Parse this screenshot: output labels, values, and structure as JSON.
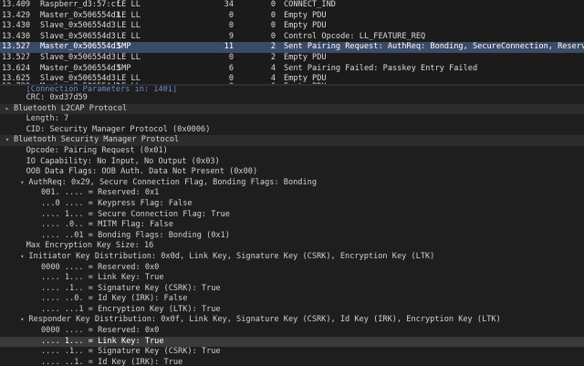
{
  "packet_list": [
    {
      "time": "13.409",
      "source": "Raspberr_d3:57:cf",
      "protocol": "LE LL",
      "length": "34",
      "num": "0",
      "info": "CONNECT_IND"
    },
    {
      "time": "13.429",
      "source": "Master_0x506554d3",
      "protocol": "LE LL",
      "length": "0",
      "num": "0",
      "info": "Empty PDU"
    },
    {
      "time": "13.430",
      "source": "Slave_0x506554d3",
      "protocol": "LE LL",
      "length": "0",
      "num": "0",
      "info": "Empty PDU"
    },
    {
      "time": "13.430",
      "source": "Slave_0x506554d3",
      "protocol": "LE LL",
      "length": "9",
      "num": "0",
      "info": "Control Opcode: LL_FEATURE_REQ"
    },
    {
      "time": "13.527",
      "source": "Master_0x506554d3",
      "protocol": "SMP",
      "length": "11",
      "num": "2",
      "info": "Sent Pairing Request: AuthReq: Bonding, SecureConnection, Reserved | I"
    },
    {
      "time": "13.527",
      "source": "Slave_0x506554d3",
      "protocol": "LE LL",
      "length": "0",
      "num": "2",
      "info": "Empty PDU"
    },
    {
      "time": "13.624",
      "source": "Master_0x506554d3",
      "protocol": "SMP",
      "length": "6",
      "num": "4",
      "info": "Sent Pairing Failed: Passkey Entry Failed"
    },
    {
      "time": "13.625",
      "source": "Slave_0x506554d3",
      "protocol": "LE LL",
      "length": "0",
      "num": "4",
      "info": "Empty PDU"
    },
    {
      "time": "13.722",
      "source": "Master_0x506554d3",
      "protocol": "LE LL",
      "length": "0",
      "num": "6",
      "info": "Empty PDU"
    }
  ],
  "detail_tree": [
    {
      "indent": 3,
      "arrow": "",
      "text": "[Connection Parameters in: 1401]",
      "partial": true
    },
    {
      "indent": 3,
      "arrow": "",
      "text": "CRC: 0xd37d59"
    },
    {
      "indent": 0,
      "arrow": "▸",
      "text": "Bluetooth L2CAP Protocol",
      "hdr": true
    },
    {
      "indent": 3,
      "arrow": "",
      "text": "Length: 7"
    },
    {
      "indent": 3,
      "arrow": "",
      "text": "CID: Security Manager Protocol (0x0006)"
    },
    {
      "indent": 0,
      "arrow": "▾",
      "text": "Bluetooth Security Manager Protocol",
      "hdr": true
    },
    {
      "indent": 3,
      "arrow": "",
      "text": "Opcode: Pairing Request (0x01)"
    },
    {
      "indent": 3,
      "arrow": "",
      "text": "IO Capability: No Input, No Output (0x03)"
    },
    {
      "indent": 3,
      "arrow": "",
      "text": "OOB Data Flags: OOB Auth. Data Not Present (0x00)"
    },
    {
      "indent": 2,
      "arrow": "▾",
      "text": "AuthReq: 0x29, Secure Connection Flag, Bonding Flags: Bonding"
    },
    {
      "indent": 5,
      "arrow": "",
      "text": "001. .... = Reserved: 0x1"
    },
    {
      "indent": 5,
      "arrow": "",
      "text": "...0 .... = Keypress Flag: False"
    },
    {
      "indent": 5,
      "arrow": "",
      "text": ".... 1... = Secure Connection Flag: True"
    },
    {
      "indent": 5,
      "arrow": "",
      "text": ".... .0.. = MITM Flag: False"
    },
    {
      "indent": 5,
      "arrow": "",
      "text": ".... ..01 = Bonding Flags: Bonding (0x1)"
    },
    {
      "indent": 3,
      "arrow": "",
      "text": "Max Encryption Key Size: 16"
    },
    {
      "indent": 2,
      "arrow": "▾",
      "text": "Initiator Key Distribution: 0x0d, Link Key, Signature Key (CSRK), Encryption Key (LTK)"
    },
    {
      "indent": 5,
      "arrow": "",
      "text": "0000 .... = Reserved: 0x0"
    },
    {
      "indent": 5,
      "arrow": "",
      "text": ".... 1... = Link Key: True"
    },
    {
      "indent": 5,
      "arrow": "",
      "text": ".... .1.. = Signature Key (CSRK): True"
    },
    {
      "indent": 5,
      "arrow": "",
      "text": ".... ..0. = Id Key (IRK): False"
    },
    {
      "indent": 5,
      "arrow": "",
      "text": ".... ...1 = Encryption Key (LTK): True"
    },
    {
      "indent": 2,
      "arrow": "▾",
      "text": "Responder Key Distribution: 0x0f, Link Key, Signature Key (CSRK), Id Key (IRK), Encryption Key (LTK)"
    },
    {
      "indent": 5,
      "arrow": "",
      "text": "0000 .... = Reserved: 0x0"
    },
    {
      "indent": 5,
      "arrow": "",
      "text": ".... 1... = Link Key: True",
      "sel": true
    },
    {
      "indent": 5,
      "arrow": "",
      "text": ".... .1.. = Signature Key (CSRK): True"
    },
    {
      "indent": 5,
      "arrow": "",
      "text": ".... ..1. = Id Key (IRK): True"
    },
    {
      "indent": 5,
      "arrow": "",
      "text": ".... ...1 = Encryption Key (LTK): True"
    }
  ],
  "selected_packet_index": 4,
  "colors": {
    "selected_row": "#3b4a66",
    "background": "#1e1e1e",
    "header_row": "#2c2c2c"
  }
}
